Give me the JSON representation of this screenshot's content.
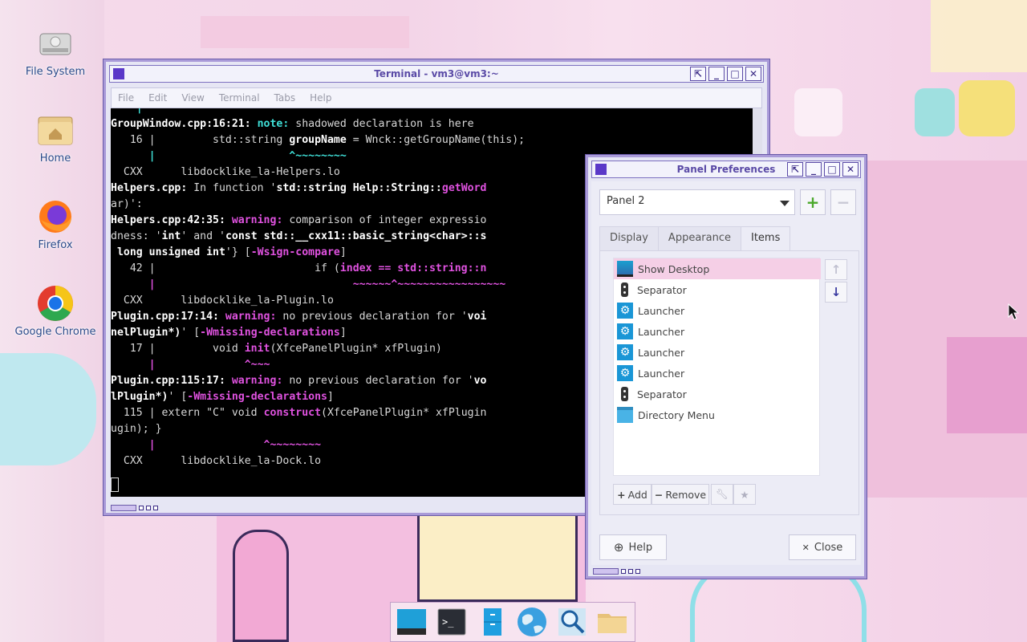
{
  "desktop": {
    "icons": [
      {
        "label": "File System",
        "icon": "drive-icon"
      },
      {
        "label": "Home",
        "icon": "home-folder-icon"
      },
      {
        "label": "Firefox",
        "icon": "firefox-icon"
      },
      {
        "label": "Google Chrome",
        "icon": "chrome-icon"
      }
    ]
  },
  "terminal": {
    "title": "Terminal - vm3@vm3:~",
    "menu": [
      "File",
      "Edit",
      "View",
      "Terminal",
      "Tabs",
      "Help"
    ],
    "lines": {
      "l0": "    |               ^~~~~~~~~",
      "l1a": "GroupWindow.cpp:16:21:",
      "l1b": " note:",
      "l1c": " shadowed declaration is here",
      "l2a": "   16 |         std::string ",
      "l2b": "groupName",
      "l2c": " = Wnck::getGroupName(this);",
      "l3": "      |                     ^~~~~~~~~",
      "l4": "  CXX      libdocklike_la-Helpers.lo",
      "l5a": "Helpers.cpp:",
      "l5b": " In function '",
      "l5c": "std::string Help::String::",
      "l5d": "getWord",
      "l6": "ar)':",
      "l7a": "Helpers.cpp:42:35:",
      "l7b": " warning:",
      "l7c": " comparison of integer expressio",
      "l8a": "dness: '",
      "l8b": "int",
      "l8c": "' and '",
      "l8d": "const std::__cxx11::basic_string<char>::s",
      "l9a": " long unsigned int",
      "l9b": "'} [",
      "l9c": "-Wsign-compare",
      "l9d": "]",
      "l10a": "   42 |                         if (",
      "l10b": "index == std::string::n",
      "l11": "      |                               ~~~~~~^~~~~~~~~~~~~~~~~~",
      "l12": "  CXX      libdocklike_la-Plugin.lo",
      "l13a": "Plugin.cpp:17:14:",
      "l13b": " warning:",
      "l13c": " no previous declaration for '",
      "l13d": "voi",
      "l14a": "nelPlugin*)",
      "l14b": "' [",
      "l14c": "-Wmissing-declarations",
      "l14d": "]",
      "l15a": "   17 |         void ",
      "l15b": "init",
      "l15c": "(XfcePanelPlugin* xfPlugin)",
      "l16": "      |              ^~~~",
      "l17a": "Plugin.cpp:115:17:",
      "l17b": " warning:",
      "l17c": " no previous declaration for '",
      "l17d": "vo",
      "l18a": "lPlugin*)",
      "l18b": "' [",
      "l18c": "-Wmissing-declarations",
      "l18d": "]",
      "l19a": "  115 | extern \"C\" void ",
      "l19b": "construct",
      "l19c": "(XfcePanelPlugin* xfPlugin",
      "l20": "ugin); }",
      "l21": "      |                 ^~~~~~~~~",
      "l22": "  CXX      libdocklike_la-Dock.lo"
    }
  },
  "panel_prefs": {
    "title": "Panel Preferences",
    "panel_select": "Panel 2",
    "tabs": [
      "Display",
      "Appearance",
      "Items"
    ],
    "active_tab": "Items",
    "items": [
      {
        "label": "Show Desktop",
        "icon": "show-desktop-icon",
        "selected": true
      },
      {
        "label": "Separator",
        "icon": "separator-icon"
      },
      {
        "label": "Launcher",
        "icon": "launcher-icon"
      },
      {
        "label": "Launcher",
        "icon": "launcher-icon"
      },
      {
        "label": "Launcher",
        "icon": "launcher-icon"
      },
      {
        "label": "Launcher",
        "icon": "launcher-icon"
      },
      {
        "label": "Separator",
        "icon": "separator-icon"
      },
      {
        "label": "Directory Menu",
        "icon": "directory-menu-icon"
      }
    ],
    "add_label": "Add",
    "remove_label": "Remove",
    "help_label": "Help",
    "close_label": "Close"
  },
  "dock": {
    "items": [
      "show-desktop-icon",
      "terminal-icon",
      "file-manager-icon",
      "web-browser-icon",
      "search-icon",
      "folder-icon"
    ]
  }
}
